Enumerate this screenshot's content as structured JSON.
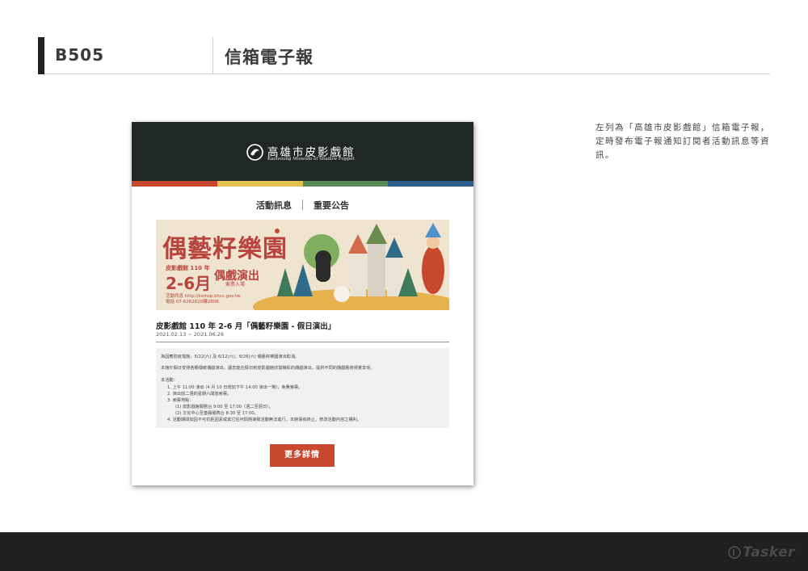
{
  "header": {
    "code": "B505",
    "title": "信箱電子報"
  },
  "note": "左列為「高雄市皮影戲館」信箱電子報，定時發布電子報通知訂閱者活動訊息等資訊。",
  "newsletter": {
    "logo_cn": "高雄市皮影戲館",
    "logo_en": "Kaohsiung Museum of Shadow Puppet",
    "stripe_colors": [
      "#c8482f",
      "#e3c14e",
      "#5b8a5a",
      "#2f5f8f"
    ],
    "nav": [
      "活動訊息",
      "重要公告"
    ],
    "banner": {
      "headline": "偶藝籽樂園",
      "sub": "皮影戲館 110 年",
      "months": "2-6月",
      "show": "偶戲演出",
      "free": "索票入場",
      "info1": "活動訊息 http://ksmsp.khcc.gov.tw",
      "info2": "電話 07-6262620轉2806"
    },
    "event_title": "皮影戲館 110 年 2-6 月「偶藝籽樂園 - 假日演出」",
    "event_date": "2021.02.13 ~ 2021.06.26",
    "info_lines": [
      "為因應防疫措施，5/22(六) 及 6/12(六)、6/26(六) 偶藝籽樂園演出取消。",
      "本館於假日安排各類傳統偶戲演出，讓您能在假日到皮影戲館欣賞精彩的偶戲演出，提供不同的偶戲藝術視覺享受。",
      "本活動：",
      "1. 上午 11:00 演出 (4 月 10 日增加下午 14:00 演出一場)，免費索票。",
      "2. 演出前二週的星期六開放索票。",
      "3. 索票地點：",
      "(1) 皮影戲館服務台 9:00 至 17:00（週二至週日）。",
      "(2) 文化中心至善廳服務台 8:30 至 17:00。",
      "4. 活動期間如因不可抗拒因素或其它任何問題導致活動無法進行，本館保有終止、修改活動內容之權利。"
    ],
    "more_button": "更多詳情"
  },
  "footer": {
    "brand": "Tasker"
  }
}
